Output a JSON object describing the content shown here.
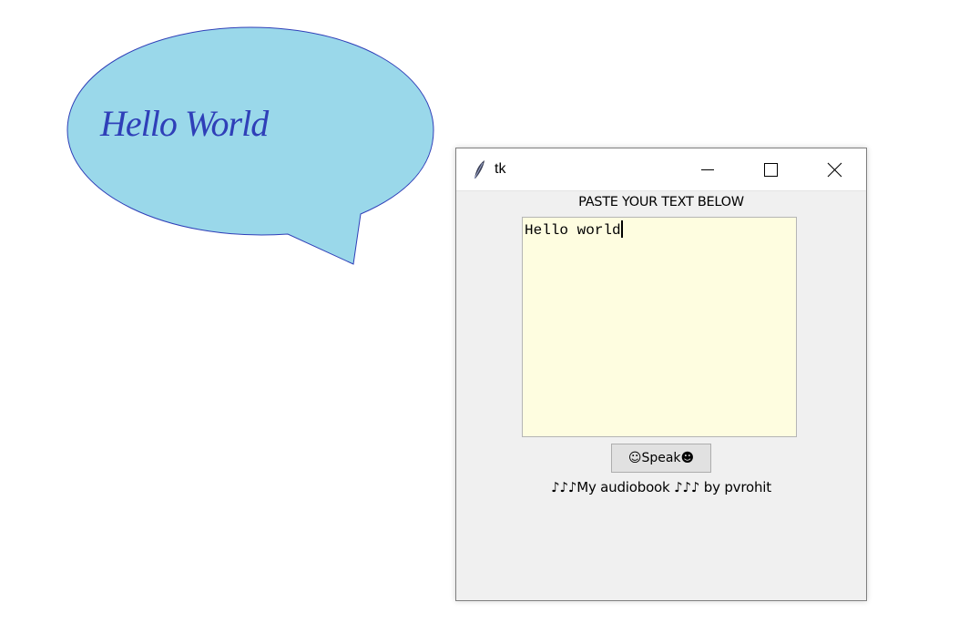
{
  "bubble": {
    "text": "Hello World",
    "fill_color": "#9ad8ea",
    "stroke_color": "#2f3fb8",
    "text_color": "#2f3fb8"
  },
  "window": {
    "title": "tk",
    "icon": "feather-icon",
    "controls": [
      "minimize-icon",
      "maximize-icon",
      "close-icon"
    ]
  },
  "app": {
    "heading": "PASTE YOUR TEXT BELOW",
    "text_value": "Hello world",
    "text_background": "#fefde0",
    "speak_label": "☺Speak☻",
    "footer": "♪♪♪My audiobook ♪♪♪ by pvrohit"
  }
}
